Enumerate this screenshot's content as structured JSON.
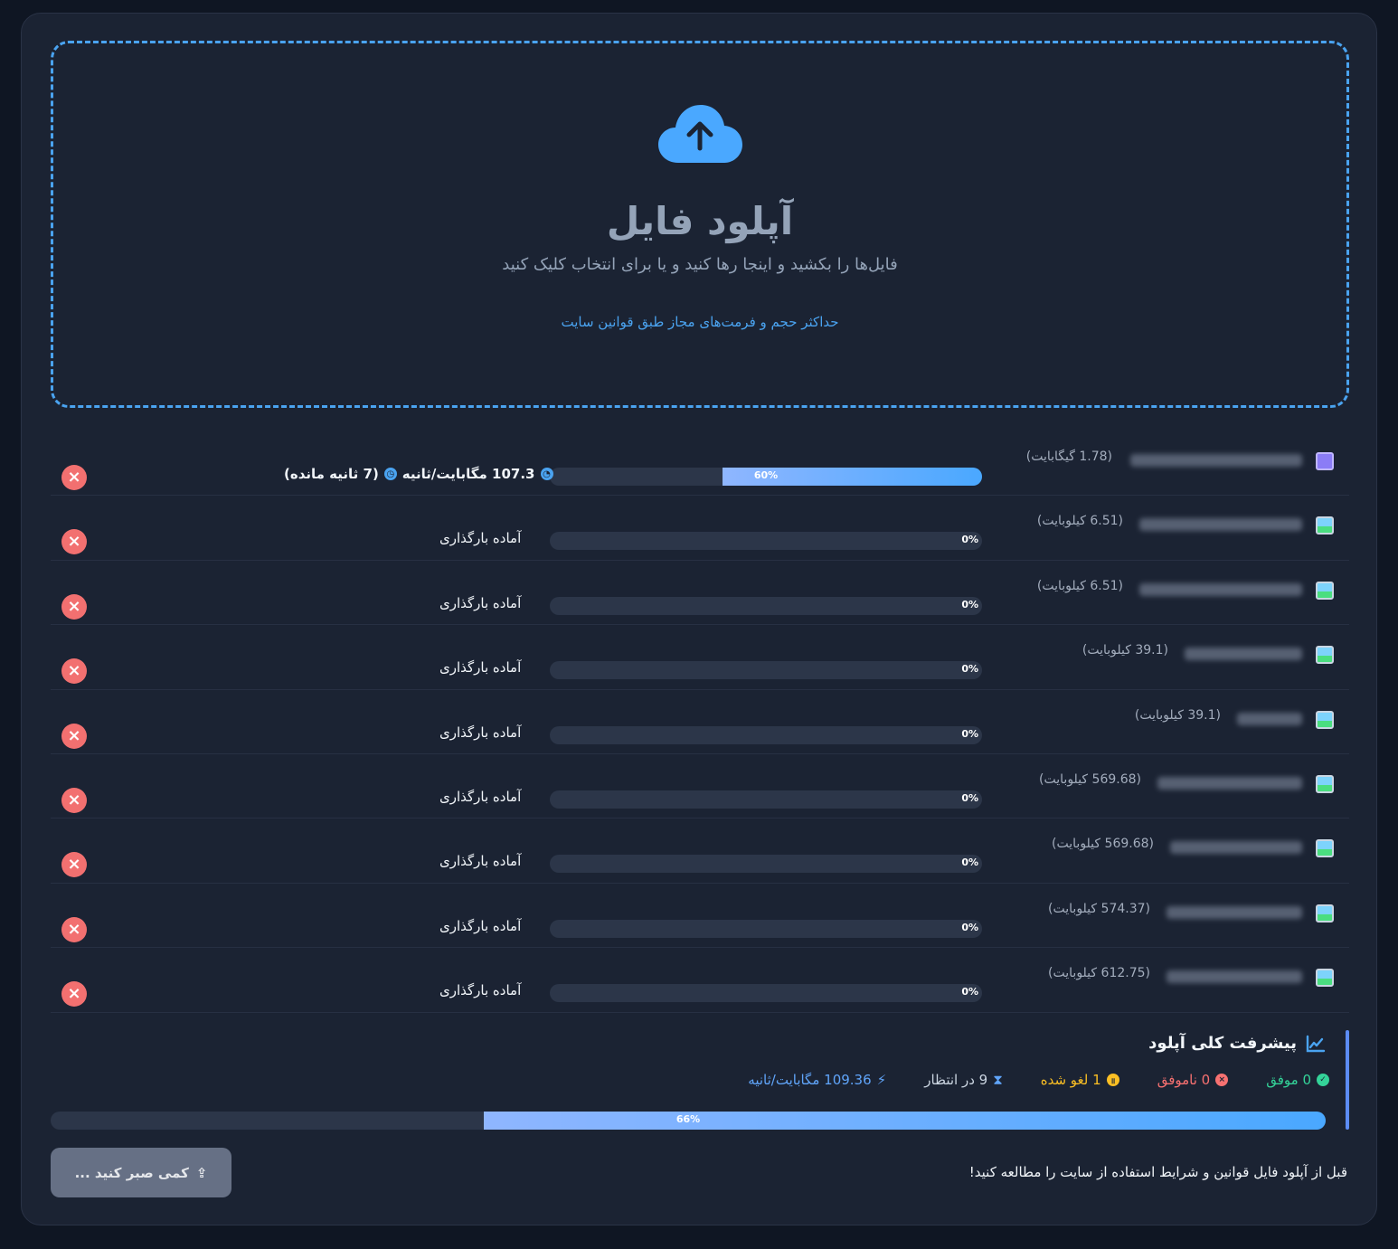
{
  "dropzone": {
    "title": "آپلود فایل",
    "subtitle": "فایل‌ها را بکشید و اینجا رها کنید و یا برای انتخاب کلیک کنید",
    "note": "حداکثر حجم و فرمت‌های مجاز طبق قوانین سایت",
    "icon": "cloud-upload-icon",
    "accent": "#4aa3f0"
  },
  "files": [
    {
      "type": "video",
      "size": "(1.78 گیگابایت)",
      "progress": 60,
      "progress_label": "60%",
      "speed": "107.3 مگابایت/ثانیه",
      "remaining": "(7 ثانیه مانده)",
      "status": ""
    },
    {
      "type": "image",
      "size": "(6.51 کیلوبایت)",
      "progress": 0,
      "progress_label": "0%",
      "status": "آماده بارگذاری"
    },
    {
      "type": "image",
      "size": "(6.51 کیلوبایت)",
      "progress": 0,
      "progress_label": "0%",
      "status": "آماده بارگذاری"
    },
    {
      "type": "image",
      "size": "(39.1 کیلوبایت)",
      "progress": 0,
      "progress_label": "0%",
      "status": "آماده بارگذاری"
    },
    {
      "type": "image",
      "size": "(39.1 کیلوبایت)",
      "progress": 0,
      "progress_label": "0%",
      "status": "آماده بارگذاری"
    },
    {
      "type": "image",
      "size": "(569.68 کیلوبایت)",
      "progress": 0,
      "progress_label": "0%",
      "status": "آماده بارگذاری"
    },
    {
      "type": "image",
      "size": "(569.68 کیلوبایت)",
      "progress": 0,
      "progress_label": "0%",
      "status": "آماده بارگذاری"
    },
    {
      "type": "image",
      "size": "(574.37 کیلوبایت)",
      "progress": 0,
      "progress_label": "0%",
      "status": "آماده بارگذاری"
    },
    {
      "type": "image",
      "size": "(612.75 کیلوبایت)",
      "progress": 0,
      "progress_label": "0%",
      "status": "آماده بارگذاری"
    }
  ],
  "overall": {
    "title": "پیشرفت کلی آپلود",
    "success": "0 موفق",
    "failed": "0 ناموفق",
    "canceled": "1 لغو شده",
    "pending": "9 در انتظار",
    "speed": "109.36 مگابایت/ثانیه",
    "progress": 66,
    "progress_label": "66%",
    "colors": {
      "success": "#34d399",
      "failed": "#f87171",
      "canceled": "#fbbf24",
      "pending": "#cbd5e1",
      "speed": "#60a5fa"
    }
  },
  "footer": {
    "note": "قبل از آپلود فایل قوانین و شرایط استفاده از سایت را مطالعه کنید!",
    "button_label": "کمی صبر کنید ...",
    "button_icon": "upload-tray-icon"
  }
}
